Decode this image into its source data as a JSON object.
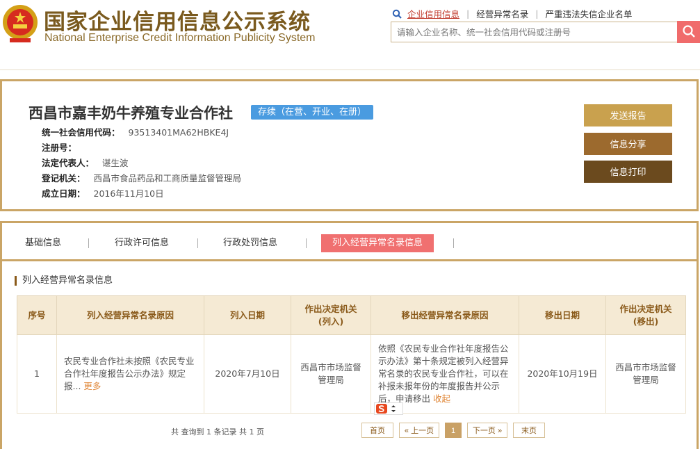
{
  "header": {
    "title_cn": "国家企业信用信息公示系统",
    "title_en": "National Enterprise Credit Information Publicity System",
    "nav": [
      "企业信用信息",
      "经营异常名录",
      "严重违法失信企业名单"
    ],
    "search_placeholder": "请输入企业名称、统一社会信用代码或注册号"
  },
  "company": {
    "name": "西昌市嘉丰奶牛养殖专业合作社",
    "status": "存续（在营、开业、在册）",
    "fields": [
      {
        "label": "统一社会信用代码：",
        "value": "93513401MA62HBKE4J"
      },
      {
        "label": "注册号：",
        "value": ""
      },
      {
        "label": "法定代表人：",
        "value": "谌生波"
      },
      {
        "label": "登记机关：",
        "value": "西昌市食品药品和工商质量监督管理局"
      },
      {
        "label": "成立日期：",
        "value": "2016年11月10日"
      }
    ]
  },
  "actions": {
    "send": "发送报告",
    "share": "信息分享",
    "print": "信息打印"
  },
  "tabs": [
    "基础信息",
    "行政许可信息",
    "行政处罚信息",
    "列入经营异常名录信息"
  ],
  "section": {
    "title": "列入经营异常名录信息"
  },
  "table": {
    "headers": [
      "序号",
      "列入经营异常名录原因",
      "列入日期",
      "作出决定机关\n(列入)",
      "移出经营异常名录原因",
      "移出日期",
      "作出决定机关\n(移出)"
    ],
    "rows": [
      {
        "no": "1",
        "reason_in": "农民专业合作社未按照《农民专业合作社年度报告公示办法》规定报...",
        "more": "更多",
        "date_in": "2020年7月10日",
        "org_in": "西昌市市场监督管理局",
        "reason_out": "依照《农民专业合作社年度报告公示办法》第十条规定被列入经营异常名录的农民专业合作社，可以在补报未报年份的年度报告并公示后，申请移出",
        "collapse": "收起",
        "date_out": "2020年10月19日",
        "org_out": "西昌市市场监督管理局"
      }
    ]
  },
  "pager": {
    "summary": "共 查询到 1 条记录 共 1 页",
    "first": "首页",
    "prev": "« 上一页",
    "current": "1",
    "next": "下一页 »",
    "last": "末页"
  },
  "colors": {
    "accent": "#caa566",
    "badge": "#4a9be0",
    "active_tab": "#f07070",
    "btn1": "#c9a14e",
    "btn2": "#9c6a2e",
    "btn3": "#6b4a1e"
  }
}
